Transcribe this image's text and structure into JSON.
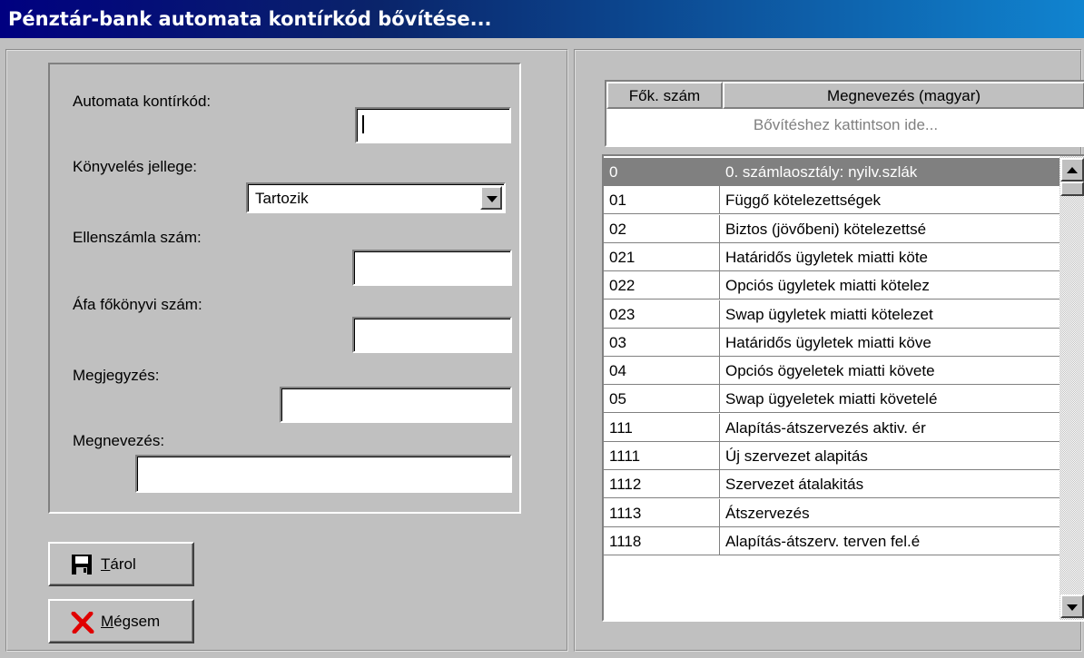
{
  "window": {
    "title": "Pénztár-bank automata kontírkód bővítése..."
  },
  "form": {
    "auto_code_label": "Automata kontírkód:",
    "auto_code_value": "",
    "booking_type_label": "Könyvelés jellege:",
    "booking_type_value": "Tartozik",
    "contra_account_label": "Ellenszámla szám:",
    "contra_account_value": "",
    "vat_ledger_label": "Áfa főkönyvi szám:",
    "vat_ledger_value": "",
    "note_label": "Megjegyzés:",
    "note_value": "",
    "name_label": "Megnevezés:",
    "name_value": ""
  },
  "buttons": {
    "save_first": "T",
    "save_rest": "árol",
    "cancel_first": "M",
    "cancel_rest": "égsem"
  },
  "icons": {
    "save": "floppy-disk-icon",
    "cancel": "red-x-icon"
  },
  "table": {
    "columns": [
      "Fők. szám",
      "Megnevezés (magyar)"
    ],
    "add_hint": "Bővítéshez kattintson ide...",
    "rows": [
      {
        "code": "0",
        "name": "0. számlaosztály: nyilv.szlák",
        "selected": true
      },
      {
        "code": "01",
        "name": "Függő kötelezettségek"
      },
      {
        "code": "02",
        "name": "Biztos (jövőbeni) kötelezettsé"
      },
      {
        "code": "021",
        "name": "Határidős ügyletek miatti köte"
      },
      {
        "code": "022",
        "name": "Opciós ügyletek miatti kötelez"
      },
      {
        "code": "023",
        "name": "Swap ügyletek miatti kötelezet"
      },
      {
        "code": "03",
        "name": "Határidős ügyletek miatti köve"
      },
      {
        "code": "04",
        "name": "Opciós ögyeletek miatti követe"
      },
      {
        "code": "05",
        "name": "Swap ügyeletek miatti követelé"
      },
      {
        "code": "111",
        "name": "Alapítás-átszervezés aktiv. ér"
      },
      {
        "code": "1111",
        "name": "Új szervezet alapitás"
      },
      {
        "code": "1112",
        "name": "Szervezet átalakitás"
      },
      {
        "code": "1113",
        "name": "Átszervezés"
      },
      {
        "code": "1118",
        "name": "Alapítás-átszerv. terven fel.é"
      }
    ]
  },
  "colors": {
    "title_start": "#000080",
    "title_end": "#1084d0",
    "selected_row": "#808080",
    "face": "#c0c0c0"
  }
}
